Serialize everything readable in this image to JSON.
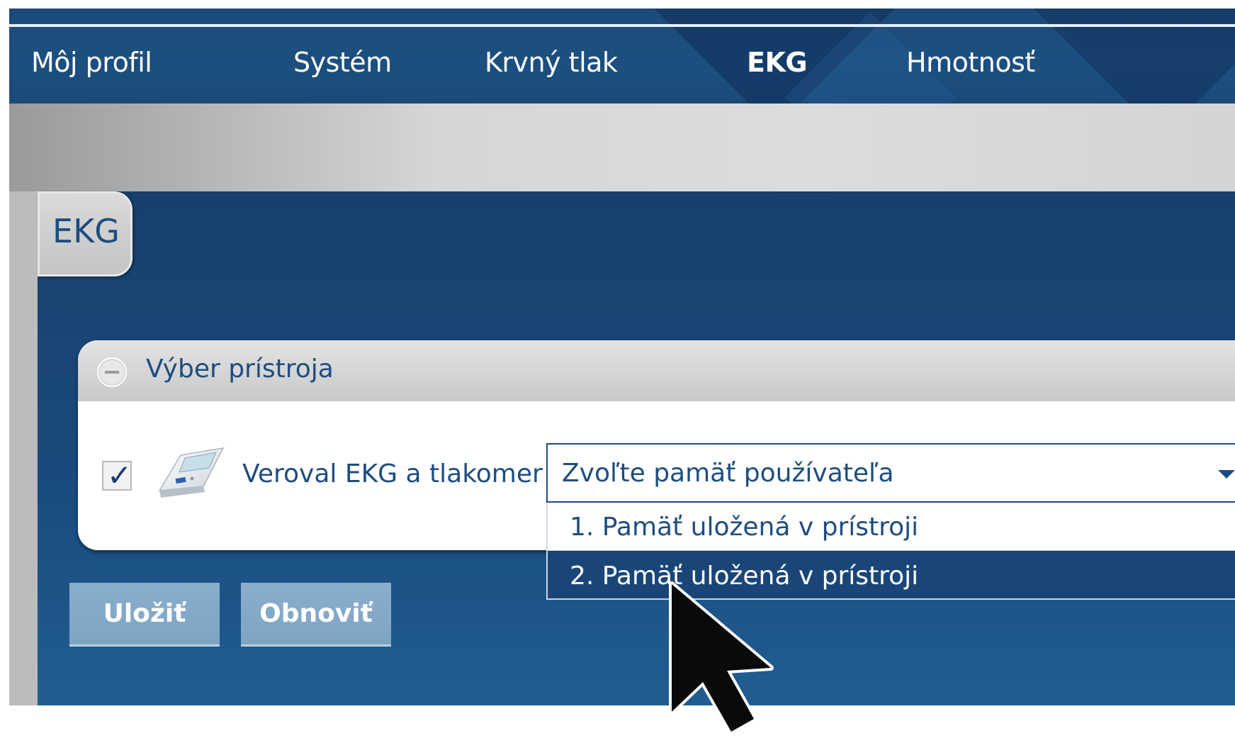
{
  "nav": {
    "items": [
      {
        "label": "Môj profil"
      },
      {
        "label": "Systém"
      },
      {
        "label": "Krvný tlak"
      },
      {
        "label": "EKG",
        "active": true
      },
      {
        "label": "Hmotnosť"
      }
    ]
  },
  "section_tab": "EKG",
  "device_panel": {
    "title": "Výber prístroja",
    "collapse_icon": "minus-circle-icon",
    "device": {
      "checked": true,
      "check_glyph": "✓",
      "label": "Veroval EKG a tlakomer",
      "icon": "blood-pressure-monitor-icon"
    },
    "memory_select": {
      "placeholder": "Zvoľte pamäť používateľa",
      "options": [
        {
          "label": "1. Pamäť uložená v prístroji"
        },
        {
          "label": "2. Pamäť uložená v prístroji",
          "highlighted": true
        }
      ]
    }
  },
  "buttons": {
    "save": "Uložiť",
    "reset": "Obnoviť"
  },
  "colors": {
    "nav_bg": "#1c4f80",
    "panel_bg": "#1a4a7c",
    "accent_text": "#1d4d80",
    "button_bg": "#7ea4c4",
    "highlight_option": "#1a4677"
  }
}
